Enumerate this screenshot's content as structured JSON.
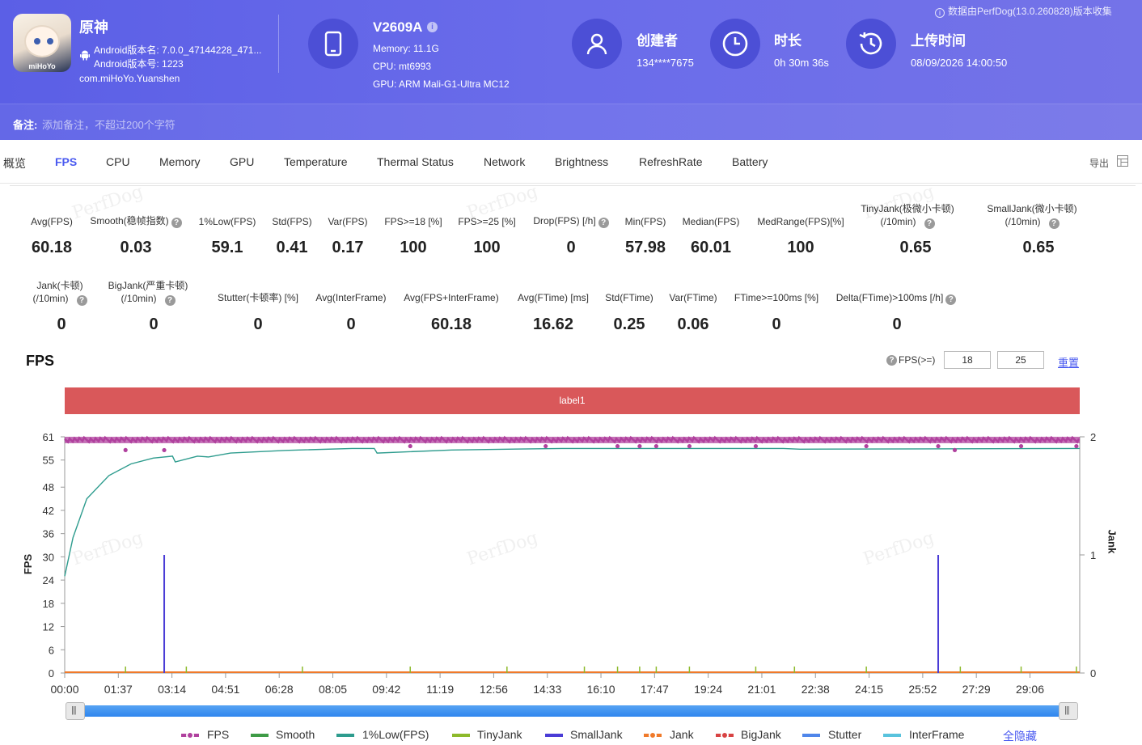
{
  "app": {
    "name": "原神",
    "version_name": "Android版本名: 7.0.0_47144228_471...",
    "version_code": "Android版本号: 1223",
    "package": "com.miHoYo.Yuanshen",
    "icon_brand": "miHoYo"
  },
  "device": {
    "model": "V2609A",
    "info_icon": "i",
    "memory": "Memory: 11.1G",
    "cpu": "CPU: mt6993",
    "gpu": "GPU: ARM Mali-G1-Ultra MC12"
  },
  "creator": {
    "title": "创建者",
    "value": "134****7675"
  },
  "duration": {
    "title": "时长",
    "value": "0h 30m 36s"
  },
  "upload": {
    "title": "上传时间",
    "value": "08/09/2026 14:00:50"
  },
  "source_note": "数据由PerfDog(13.0.260828)版本收集",
  "note": {
    "label": "备注:",
    "placeholder": "添加备注，不超过200个字符"
  },
  "tabs": [
    "概览",
    "FPS",
    "CPU",
    "Memory",
    "GPU",
    "Temperature",
    "Thermal Status",
    "Network",
    "Brightness",
    "RefreshRate",
    "Battery"
  ],
  "active_tab": "FPS",
  "export_label": "导出",
  "watermark": "PerfDog",
  "metrics_row1": [
    {
      "label": "Avg(FPS)",
      "value": "60.18"
    },
    {
      "label": "Smooth(稳帧指数)",
      "value": "0.03"
    },
    {
      "label": "1%Low(FPS)",
      "value": "59.1"
    },
    {
      "label": "Std(FPS)",
      "value": "0.41"
    },
    {
      "label": "Var(FPS)",
      "value": "0.17"
    },
    {
      "label": "FPS>=18 [%]",
      "value": "100"
    },
    {
      "label": "FPS>=25 [%]",
      "value": "100"
    },
    {
      "label": "Drop(FPS) [/h]",
      "value": "0"
    },
    {
      "label": "Min(FPS)",
      "value": "57.98"
    },
    {
      "label": "Median(FPS)",
      "value": "60.01"
    },
    {
      "label": "MedRange(FPS)[%]",
      "value": "100"
    },
    {
      "label": "TinyJank(极微小卡顿)",
      "label2": "(/10min)",
      "value": "0.65"
    },
    {
      "label": "SmallJank(微小卡顿)",
      "label2": "(/10min)",
      "value": "0.65"
    }
  ],
  "metrics_row2": [
    {
      "label": "Jank(卡顿)",
      "label2": "(/10min)",
      "value": "0"
    },
    {
      "label": "BigJank(严重卡顿)",
      "label2": "(/10min)",
      "value": "0"
    },
    {
      "label": "Stutter(卡顿率) [%]",
      "value": "0"
    },
    {
      "label": "Avg(InterFrame)",
      "value": "0"
    },
    {
      "label": "Avg(FPS+InterFrame)",
      "value": "60.18"
    },
    {
      "label": "Avg(FTime) [ms]",
      "value": "16.62"
    },
    {
      "label": "Std(FTime)",
      "value": "0.25"
    },
    {
      "label": "Var(FTime)",
      "value": "0.06"
    },
    {
      "label": "FTime>=100ms [%]",
      "value": "0"
    },
    {
      "label": "Delta(FTime)>100ms [/h]",
      "value": "0"
    }
  ],
  "chart_header": {
    "title": "FPS",
    "threshold_label": "FPS(>=)",
    "threshold_1": "18",
    "threshold_2": "25",
    "reset_label": "重置",
    "band_label": "label1"
  },
  "chart_data": {
    "type": "line",
    "title": "FPS",
    "ylabel": "FPS",
    "y2label": "Jank",
    "y_ticks": [
      "0",
      "6",
      "12",
      "18",
      "24",
      "30",
      "36",
      "42",
      "48",
      "55",
      "61"
    ],
    "y2_ticks": [
      "0",
      "1",
      "2"
    ],
    "ylim": [
      0,
      61
    ],
    "y2lim": [
      0,
      2
    ],
    "x_ticks": [
      "00:00",
      "01:37",
      "03:14",
      "04:51",
      "06:28",
      "08:05",
      "09:42",
      "11:19",
      "12:56",
      "14:33",
      "16:10",
      "17:47",
      "19:24",
      "21:01",
      "22:38",
      "24:15",
      "25:52",
      "27:29",
      "29:06"
    ],
    "xlim_seconds": [
      0,
      1836
    ],
    "series": [
      {
        "name": "FPS",
        "color": "#b0419e",
        "typical": 60.18,
        "dips": [
          [
            110,
            58
          ],
          [
            180,
            57.98
          ],
          [
            625,
            59
          ],
          [
            870,
            59
          ],
          [
            1000,
            59
          ],
          [
            1040,
            59
          ],
          [
            1070,
            59
          ],
          [
            1130,
            59
          ],
          [
            1250,
            59
          ],
          [
            1450,
            59
          ],
          [
            1580,
            59
          ],
          [
            1610,
            58
          ],
          [
            1730,
            59
          ],
          [
            1830,
            59
          ]
        ]
      },
      {
        "name": "Smooth",
        "color": "#3e9b46",
        "values": []
      },
      {
        "name": "1%Low(FPS)",
        "color": "#2e9c8e",
        "points": [
          [
            0,
            25
          ],
          [
            15,
            35
          ],
          [
            40,
            45
          ],
          [
            80,
            51
          ],
          [
            120,
            54
          ],
          [
            160,
            55.5
          ],
          [
            195,
            56
          ],
          [
            200,
            54.5
          ],
          [
            240,
            56
          ],
          [
            260,
            55.8
          ],
          [
            300,
            56.8
          ],
          [
            400,
            57.5
          ],
          [
            520,
            58
          ],
          [
            560,
            58
          ],
          [
            565,
            56.8
          ],
          [
            700,
            57.6
          ],
          [
            900,
            58
          ],
          [
            1300,
            58
          ],
          [
            1330,
            57.8
          ],
          [
            1836,
            58
          ]
        ]
      },
      {
        "name": "TinyJank",
        "color": "#8dba2b",
        "times": [
          110,
          180,
          220,
          430,
          625,
          800,
          940,
          1000,
          1040,
          1070,
          1130,
          1250,
          1320,
          1450,
          1580,
          1620,
          1730,
          1830
        ]
      },
      {
        "name": "SmallJank",
        "color": "#4a3cd6",
        "times": [
          180,
          1580
        ],
        "value": 1
      }
    ],
    "legend": [
      "FPS",
      "Smooth",
      "1%Low(FPS)",
      "TinyJank",
      "SmallJank",
      "Jank",
      "BigJank",
      "Stutter",
      "InterFrame"
    ],
    "legend_colors": [
      "#b0419e",
      "#3e9b46",
      "#2e9c8e",
      "#8dba2b",
      "#4a3cd6",
      "#f07a2a",
      "#d84343",
      "#4f86ea",
      "#59c3dd"
    ],
    "legend_placement": "bottom"
  },
  "legend_hide_all": "全隐藏"
}
